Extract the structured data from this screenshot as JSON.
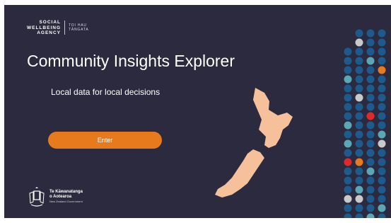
{
  "agency_logo": {
    "name_lines": [
      "SOCIAL",
      "WELLBEING",
      "AGENCY"
    ],
    "maori_lines": [
      "TOI HAU",
      "TĀNGATA"
    ]
  },
  "title": "Community Insights Explorer",
  "subtitle": "Local data for local decisions",
  "enter_button": {
    "label": "Enter"
  },
  "gov_logo": {
    "line1": "Te Kāwanatanga",
    "line2": "o Aotearoa",
    "line3": "New Zealand Government"
  },
  "colors": {
    "background": "#2b2a3e",
    "accent": "#e87a1e",
    "map": "#f5c09a",
    "dot_blue": "#1d5b8f",
    "dot_teal": "#5aa7b6",
    "dot_red": "#e02a2a",
    "dot_grey": "#c9c9c9"
  }
}
